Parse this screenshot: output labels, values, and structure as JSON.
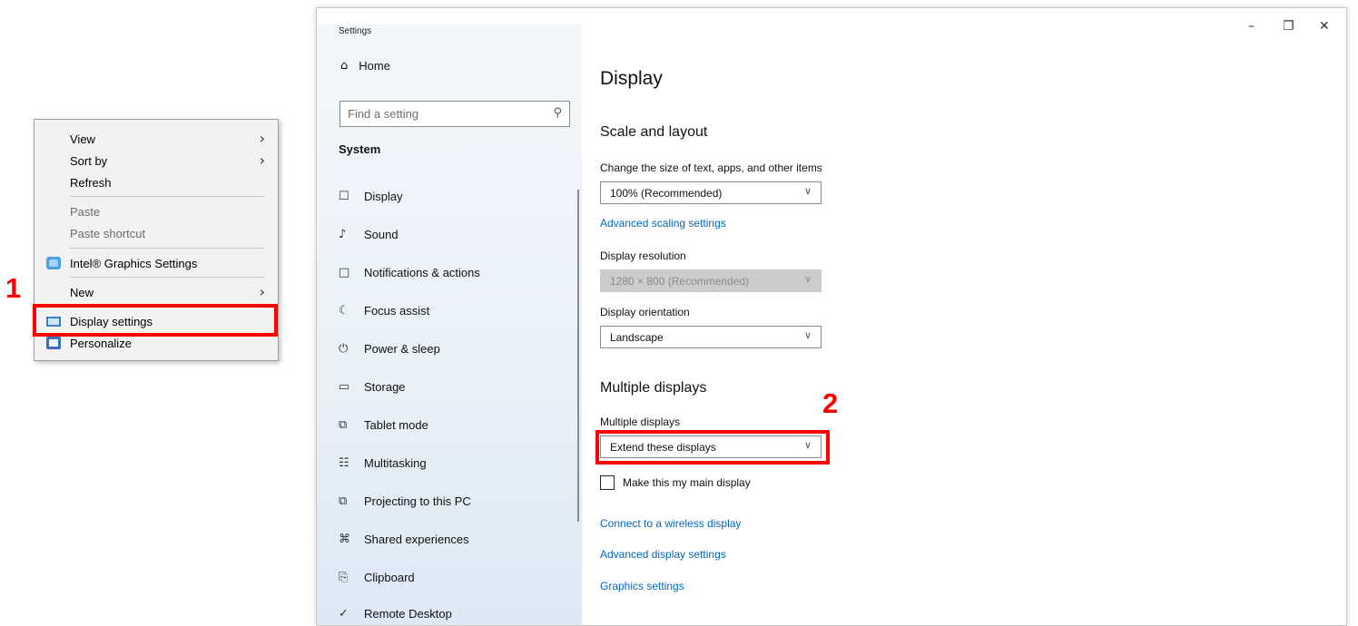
{
  "context_menu": {
    "items": [
      {
        "label": "View",
        "has_submenu": true,
        "disabled": false
      },
      {
        "label": "Sort by",
        "has_submenu": true,
        "disabled": false
      },
      {
        "label": "Refresh",
        "has_submenu": false,
        "disabled": false
      },
      {
        "label": "Paste",
        "has_submenu": false,
        "disabled": true
      },
      {
        "label": "Paste shortcut",
        "has_submenu": false,
        "disabled": true
      },
      {
        "label": "Intel® Graphics Settings",
        "has_submenu": false,
        "disabled": false,
        "icon": "intel-graphics-icon"
      },
      {
        "label": "New",
        "has_submenu": true,
        "disabled": false
      },
      {
        "label": "Display settings",
        "has_submenu": false,
        "disabled": false,
        "icon": "display-settings-icon"
      },
      {
        "label": "Personalize",
        "has_submenu": false,
        "disabled": false,
        "icon": "personalize-icon"
      }
    ]
  },
  "annotations": {
    "step1": "1",
    "step2": "2",
    "highlight_color": "#ff0000"
  },
  "window": {
    "title": "Settings",
    "controls": {
      "minimize": "–",
      "restore": "❐",
      "close": "✕"
    }
  },
  "sidebar": {
    "home_label": "Home",
    "search_placeholder": "Find a setting",
    "section_label": "System",
    "items": [
      {
        "label": "Display",
        "icon": "monitor-icon",
        "glyph": "☐"
      },
      {
        "label": "Sound",
        "icon": "speaker-icon",
        "glyph": "♪"
      },
      {
        "label": "Notifications & actions",
        "icon": "message-icon",
        "glyph": "□"
      },
      {
        "label": "Focus assist",
        "icon": "moon-icon",
        "glyph": "☾"
      },
      {
        "label": "Power & sleep",
        "icon": "power-icon",
        "glyph": "⏻"
      },
      {
        "label": "Storage",
        "icon": "drive-icon",
        "glyph": "▭"
      },
      {
        "label": "Tablet mode",
        "icon": "tablet-icon",
        "glyph": "⧉"
      },
      {
        "label": "Multitasking",
        "icon": "multitask-icon",
        "glyph": "☷"
      },
      {
        "label": "Projecting to this PC",
        "icon": "project-icon",
        "glyph": "⧉"
      },
      {
        "label": "Shared experiences",
        "icon": "share-icon",
        "glyph": "⌘"
      },
      {
        "label": "Clipboard",
        "icon": "clipboard-icon",
        "glyph": "⎘"
      },
      {
        "label": "Remote Desktop",
        "icon": "remote-icon",
        "glyph": "✓"
      }
    ]
  },
  "main": {
    "title": "Display",
    "scale_section": "Scale and layout",
    "scale_label": "Change the size of text, apps, and other items",
    "scale_value": "100% (Recommended)",
    "advanced_scaling_link": "Advanced scaling settings",
    "resolution_label": "Display resolution",
    "resolution_value": "1280 × 800 (Recommended)",
    "orientation_label": "Display orientation",
    "orientation_value": "Landscape",
    "multi_section": "Multiple displays",
    "multi_label": "Multiple displays",
    "multi_value": "Extend these displays",
    "main_display_checkbox": "Make this my main display",
    "main_display_checked": false,
    "wireless_link": "Connect to a wireless display",
    "advanced_display_link": "Advanced display settings",
    "graphics_link": "Graphics settings",
    "chevron": "∨"
  }
}
